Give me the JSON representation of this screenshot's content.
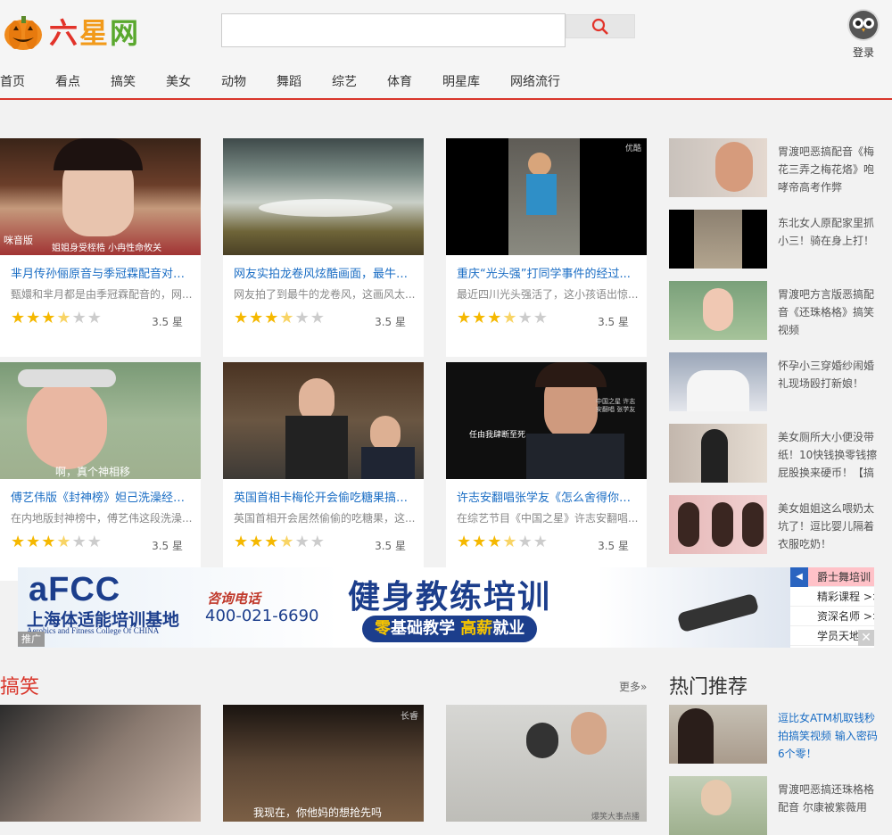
{
  "header": {
    "logo_text": [
      "六",
      "星",
      "网"
    ],
    "search": {
      "value": "",
      "placeholder": ""
    },
    "login_label": "登录"
  },
  "nav": [
    "首页",
    "看点",
    "搞笑",
    "美女",
    "动物",
    "舞蹈",
    "综艺",
    "体育",
    "明星库",
    "网络流行"
  ],
  "cards": [
    {
      "title": "芈月传孙俪原音与季冠霖配音对比...",
      "desc": "甄嬛和芈月都是由季冠霖配音的，网...",
      "stars": 3.5,
      "score": "3.5 星",
      "caption": "姐姐身受桎梏 小冉性命攸关",
      "watermark": "咪音版"
    },
    {
      "title": "网友实拍龙卷风炫酷画面，最牛的...",
      "desc": "网友拍了到最牛的龙卷风，这画风太...",
      "stars": 3.5,
      "score": "3.5 星"
    },
    {
      "title": "重庆“光头强”打同学事件的经过...",
      "desc": "最近四川光头强活了，这小孩语出惊...",
      "stars": 3.5,
      "score": "3.5 星",
      "watermark": "优酷"
    },
    {
      "title": "傅艺伟版《封神榜》妲己洗澡经典...",
      "desc": "在内地版封神榜中，傅艺伟这段洗澡...",
      "stars": 3.5,
      "score": "3.5 星",
      "caption": "啊，真个神相移"
    },
    {
      "title": "英国首相卡梅伦开会偷吃糖果搞笑...",
      "desc": "英国首相开会居然偷偷的吃糖果，这...",
      "stars": 3.5,
      "score": "3.5 星"
    },
    {
      "title": "许志安翻唱张学友《怎么舍得你》...",
      "desc": "在综艺节目《中国之星》许志安翻唱...",
      "stars": 3.5,
      "score": "3.5 星",
      "caption": "任由我肆断至死",
      "watermark": "中国之星 许志安翻唱 张学友"
    }
  ],
  "side": [
    "胃渡吧恶搞配音《梅花三弄之梅花烙》咆哮帝高考作弊",
    "东北女人原配家里抓小三！骑在身上打！",
    "胃渡吧方言版恶搞配音《还珠格格》搞笑视频",
    "怀孕小三穿婚纱闹婚礼现场殴打新娘！",
    "美女厕所大小便没带纸！10快钱换零钱擦屁股换来硬币！【搞",
    "美女姐姐这么喂奶太坑了！逗比婴儿隔着衣服吃奶！"
  ],
  "ad": {
    "brand": "aFCC",
    "brand_cn": "上海体适能培训基地",
    "brand_en": "Aerobics and Fitness College Of CHINA",
    "consult": "咨询电话",
    "phone": "400-021-6690",
    "headline": "健身教练培训",
    "sub_hl": "零",
    "sub_mid": "基础教学",
    "sub_hl2": "高薪",
    "sub_end": "就业",
    "tag": "推广",
    "close": "✕",
    "menu": [
      "爵士舞培训 >>",
      "精彩课程 >>",
      "资深名师 >>",
      "学员天地 >>"
    ]
  },
  "sections": {
    "gx": "搞笑",
    "more": "更多»",
    "hot": "热门推荐"
  },
  "bottom_thumbs": [
    {
      "caption": ""
    },
    {
      "caption": "我现在，你他妈的想抢先吗",
      "watermark": "长睿"
    },
    {
      "caption": "",
      "watermark": "爆笑大事点播"
    }
  ],
  "hot_side": [
    "逗比女ATM机取钱秒拍搞笑视频 输入密码6个零！",
    "胃渡吧恶搞还珠格格配音 尔康被紫薇用"
  ],
  "colors": {
    "accent": "#d9362b",
    "link": "#1a6dc4",
    "star": "#f5b800"
  }
}
